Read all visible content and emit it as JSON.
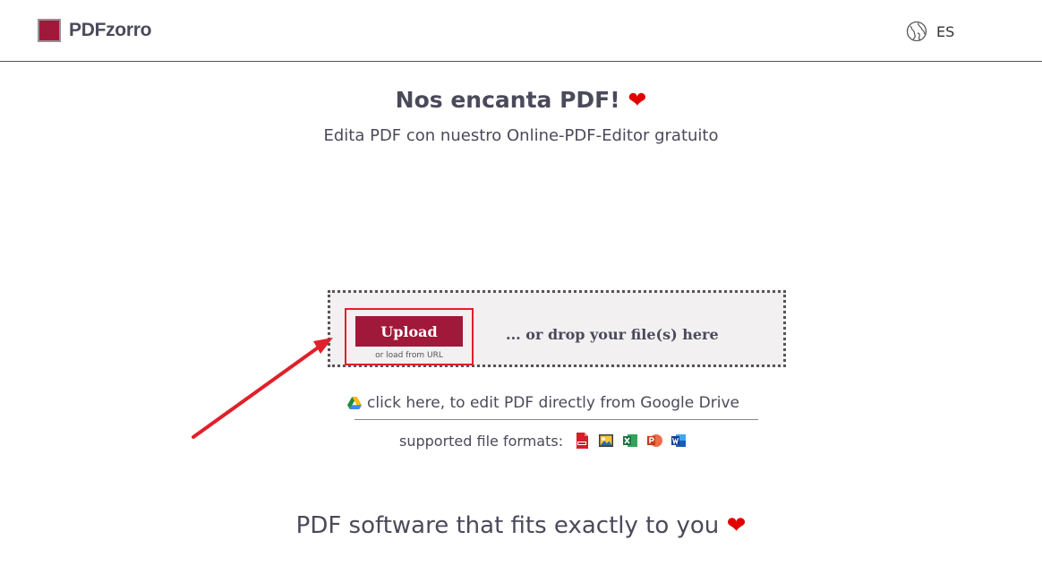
{
  "header": {
    "brand": "PDFzorro",
    "language": "ES",
    "icons": {
      "logo": "square-logo-icon",
      "language": "globe-icon"
    }
  },
  "hero": {
    "title": "Nos encanta PDF!",
    "subtitle": "Edita PDF con nuestro Online-PDF-Editor gratuito",
    "heart": "❤"
  },
  "dropzone": {
    "upload_label": "Upload",
    "load_url_label": "or load from URL",
    "drop_text": "... or drop your file(s) here"
  },
  "gdrive": {
    "text": "click here, to edit PDF directly from Google Drive",
    "icon": "google-drive-icon"
  },
  "formats": {
    "label": "supported file formats:",
    "icons": [
      "pdf-icon",
      "image-icon",
      "excel-icon",
      "powerpoint-icon",
      "word-icon"
    ]
  },
  "tagline": {
    "text": "PDF software that fits exactly to you",
    "heart": "❤"
  },
  "colors": {
    "brand": "#a0193a",
    "highlight": "#e0202a",
    "heart": "#e00000",
    "text": "#4a4a5a"
  }
}
